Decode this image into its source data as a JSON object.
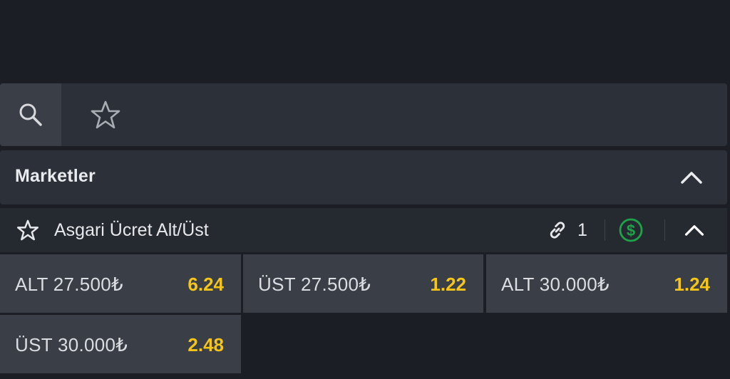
{
  "toolbar": {
    "search_icon": "search-icon",
    "favorite_icon": "star-outline-icon"
  },
  "section": {
    "title": "Marketler",
    "collapse_icon": "chevron-up-icon"
  },
  "market": {
    "name": "Asgari Ücret Alt/Üst",
    "link_icon": "link-icon",
    "link_count": "1",
    "cashout_icon": "dollar-circle-icon",
    "collapse_icon": "chevron-up-icon",
    "odds": [
      {
        "label": "ALT  27.500₺",
        "value": "6.24"
      },
      {
        "label": "ÜST  27.500₺",
        "value": "1.22"
      },
      {
        "label": "ALT  30.000₺",
        "value": "1.24"
      },
      {
        "label": "ÜST  30.000₺",
        "value": "2.48"
      }
    ]
  },
  "colors": {
    "background": "#1b1e24",
    "panel": "#2c3038",
    "button": "#3a3e46",
    "odd_value": "#f5c518",
    "cashout_green": "#1fa34a"
  }
}
